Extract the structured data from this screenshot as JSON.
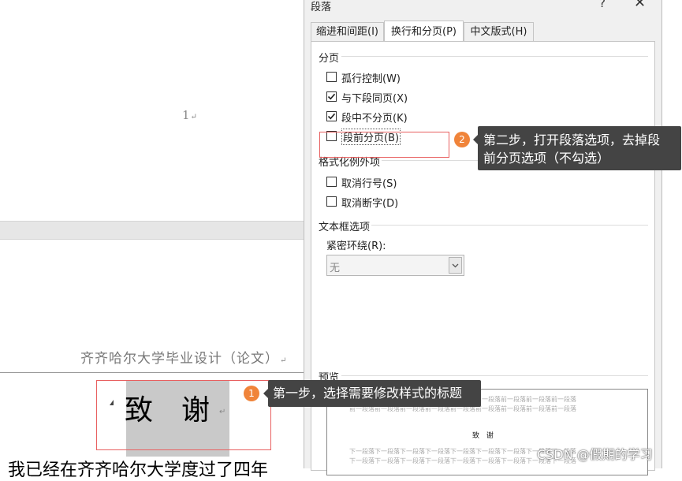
{
  "document": {
    "page_number": "1",
    "pilcrow": "↵",
    "header_text": "齐齐哈尔大学毕业设计（论文）",
    "heading_text": "致　谢",
    "body_text": "我已经在齐齐哈尔大学度过了四年"
  },
  "dialog": {
    "title": "段落",
    "help": "?",
    "close": "✕",
    "tabs": [
      {
        "label": "缩进和间距(I)"
      },
      {
        "label": "换行和分页(P)"
      },
      {
        "label": "中文版式(H)"
      }
    ],
    "pagination": {
      "title": "分页",
      "options": [
        {
          "label": "孤行控制(W)",
          "checked": false
        },
        {
          "label": "与下段同页(X)",
          "checked": true
        },
        {
          "label": "段中不分页(K)",
          "checked": true
        },
        {
          "label": "段前分页(B)",
          "checked": false
        }
      ]
    },
    "format_exceptions": {
      "title": "格式化例外项",
      "options": [
        {
          "label": "取消行号(S)",
          "checked": false
        },
        {
          "label": "取消断字(D)",
          "checked": false
        }
      ]
    },
    "textbox": {
      "title": "文本框选项",
      "wrap_label": "紧密环绕(R):",
      "wrap_value": "无"
    },
    "preview": {
      "title": "预览",
      "prev_text": "前一段落前一段落前一段落前一段落前一段落前一段落前一段落前一段落前一段落",
      "sample": "致 谢",
      "next_text": "下一段落下一段落下一段落下一段落下一段落下一段落下一段落下一段落下一段落"
    }
  },
  "annotations": {
    "step1_number": "1",
    "step1_text": "第一步，选择需要修改样式的标题",
    "step2_number": "2",
    "step2_line1": "第二步，打开段落选项，去掉段",
    "step2_line2": "前分页选项（不勾选）"
  },
  "watermark": "CSDN @假期的学习",
  "colors": {
    "badge": "#f0843a",
    "tooltip": "#444444",
    "highlight_box": "#e86060",
    "selection": "#c9c9c9"
  }
}
